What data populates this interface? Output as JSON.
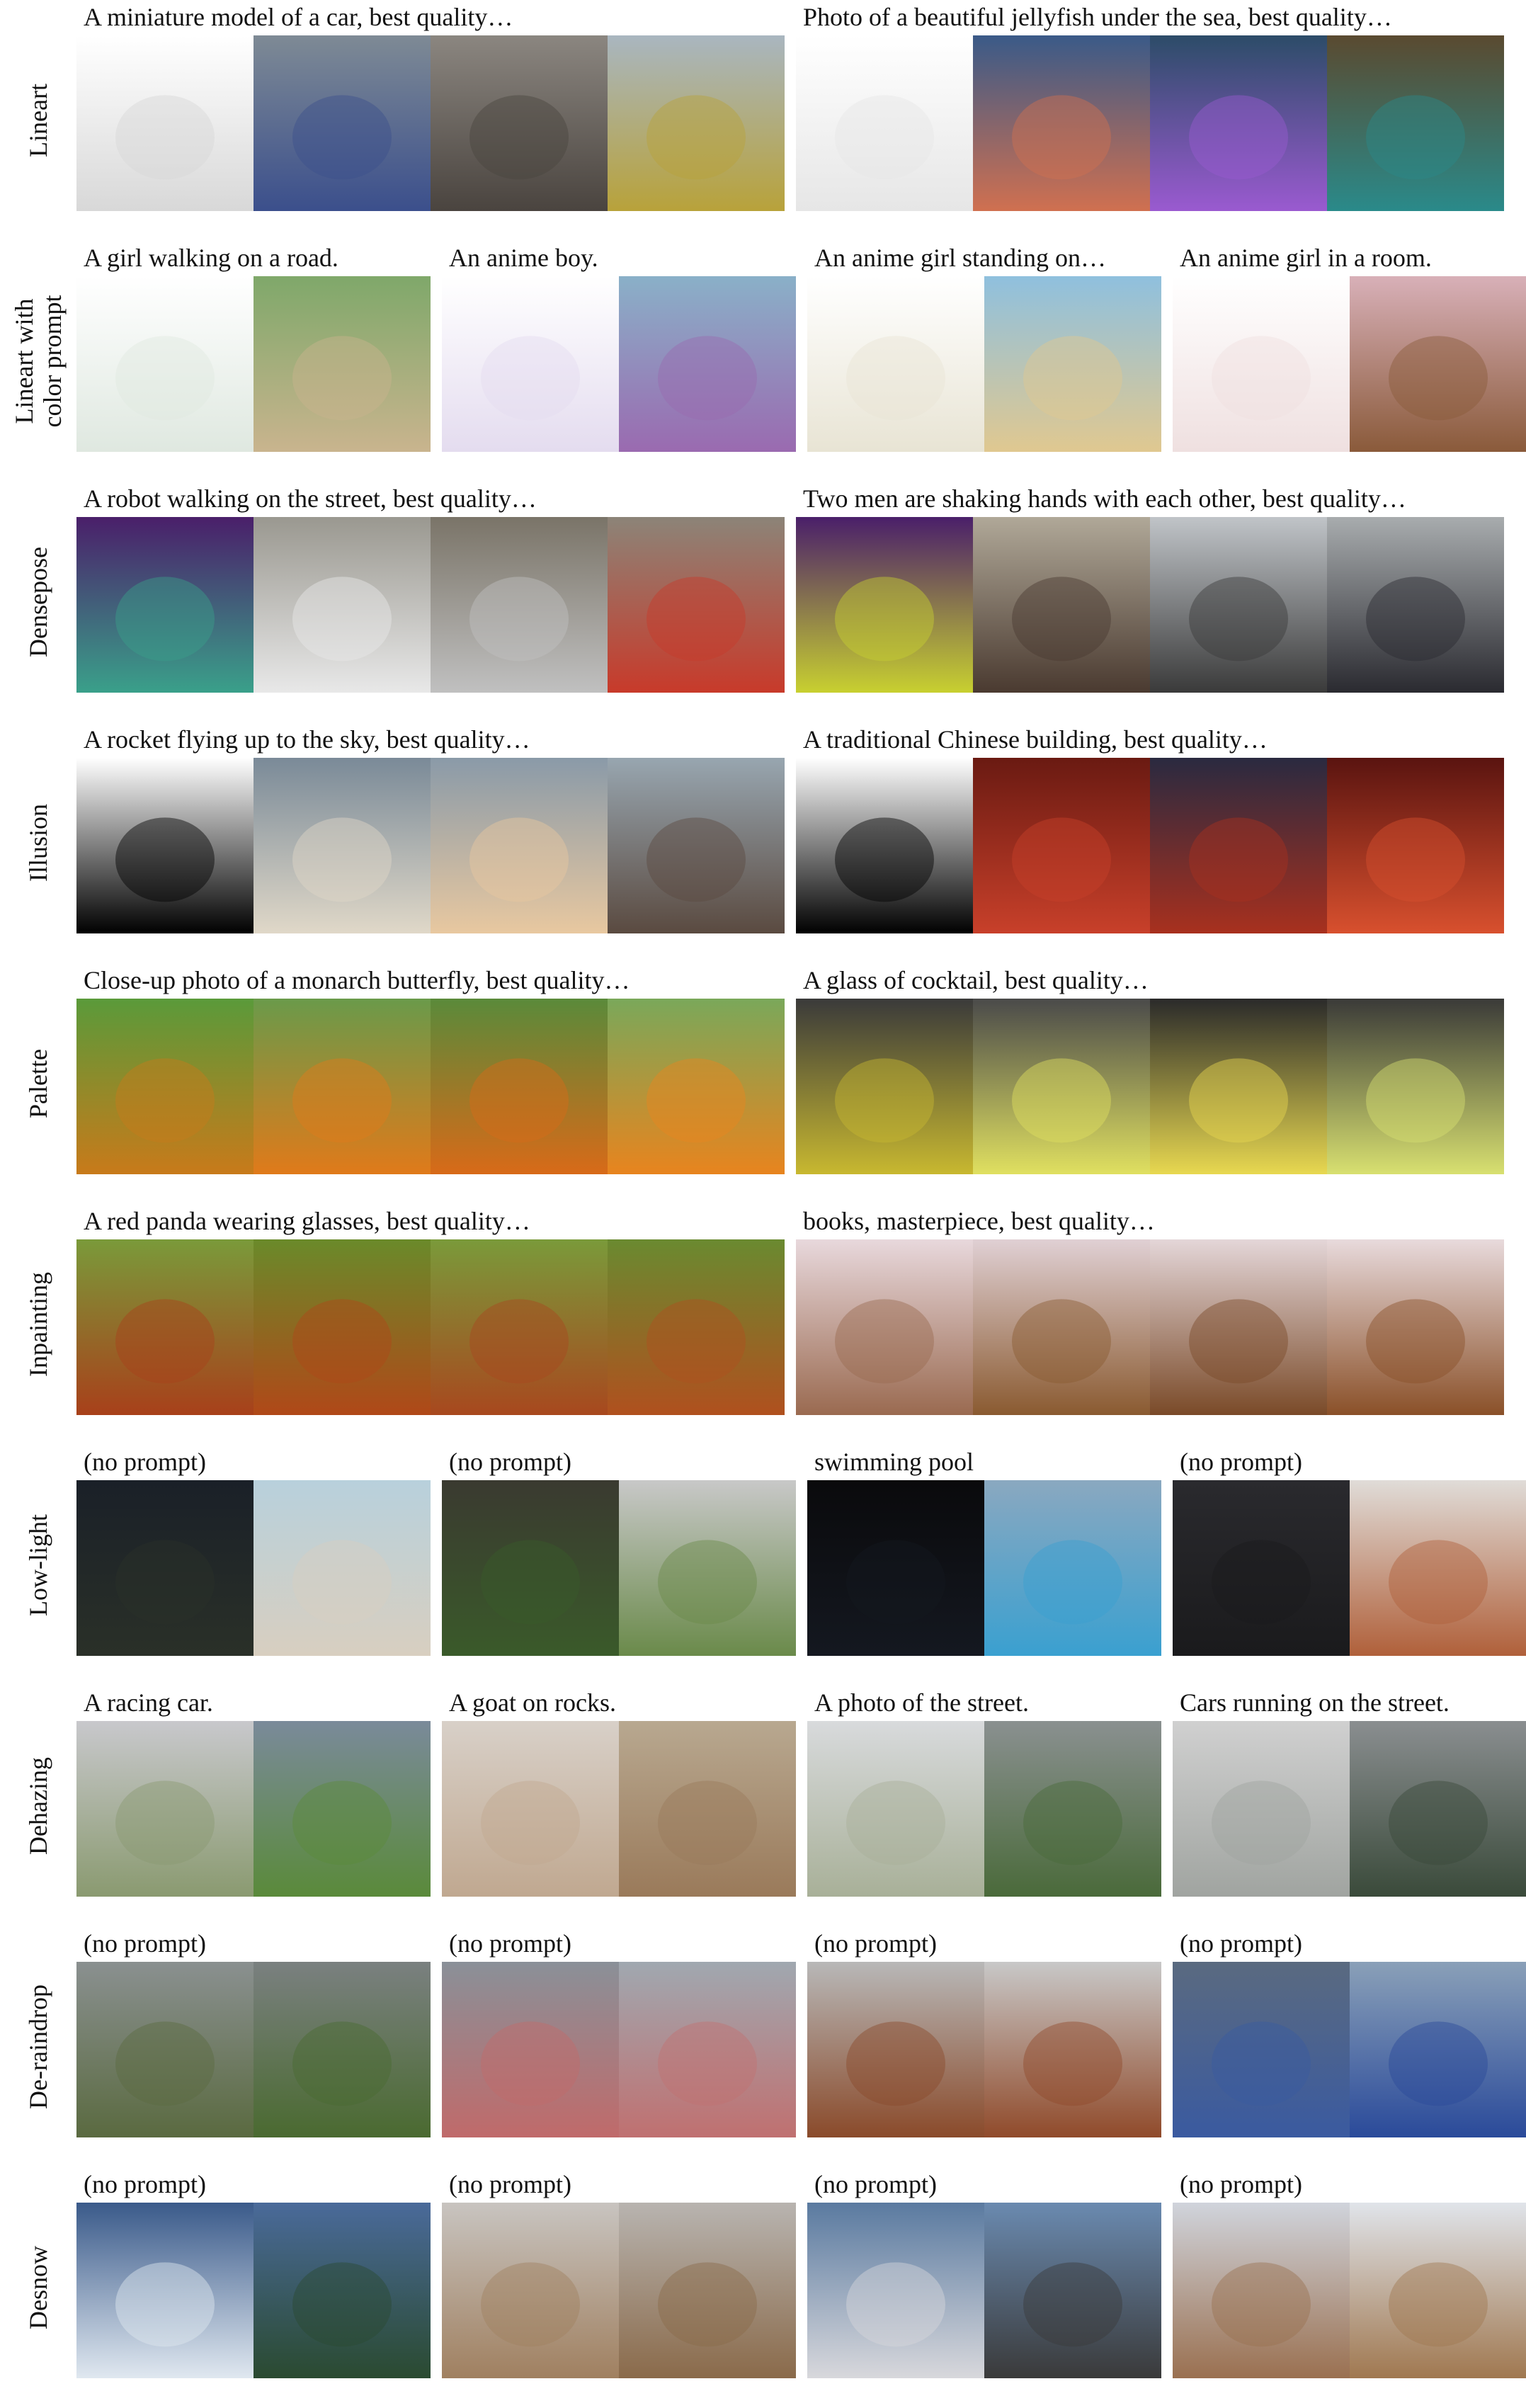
{
  "rows": [
    {
      "label": "Lineart",
      "groups": [
        {
          "caption": "A miniature model of a car, best quality…",
          "panels": [
            {
              "icon": "car-sketch",
              "a": "#ffffff",
              "b": "#d8d8d8"
            },
            {
              "icon": "car-photo-blue",
              "a": "#7e8a95",
              "b": "#3b4f8c"
            },
            {
              "icon": "car-photo-white",
              "a": "#8b8680",
              "b": "#4a443f"
            },
            {
              "icon": "car-photo-yellow",
              "a": "#a9b6c0",
              "b": "#b8a23a"
            }
          ]
        },
        {
          "caption": "Photo of a beautiful jellyfish under the sea, best quality…",
          "panels": [
            {
              "icon": "jellyfish-sketch",
              "a": "#ffffff",
              "b": "#e6e6e6"
            },
            {
              "icon": "jellyfish-red",
              "a": "#3a5a88",
              "b": "#d07050"
            },
            {
              "icon": "jellyfish-purple",
              "a": "#2c4c68",
              "b": "#9a5ad0"
            },
            {
              "icon": "jellyfish-teal",
              "a": "#5a4a30",
              "b": "#2a8a8a"
            }
          ]
        }
      ]
    },
    {
      "label": "Lineart with\ncolor prompt",
      "groups": [
        {
          "caption": "A girl walking on a road.",
          "panels": [
            {
              "icon": "color-dots-sketch",
              "a": "#ffffff",
              "b": "#dfe8e0"
            },
            {
              "icon": "anime-girl-road",
              "a": "#7fa86a",
              "b": "#c9b48e"
            }
          ]
        },
        {
          "caption": "An anime boy.",
          "panels": [
            {
              "icon": "color-dots-sketch",
              "a": "#ffffff",
              "b": "#e4dcef"
            },
            {
              "icon": "anime-boy",
              "a": "#8ab0c8",
              "b": "#9a6ab0"
            }
          ]
        },
        {
          "caption": "An anime girl standing on…",
          "panels": [
            {
              "icon": "color-dots-sketch",
              "a": "#ffffff",
              "b": "#e8e4d4"
            },
            {
              "icon": "anime-girl-beach",
              "a": "#8fc0de",
              "b": "#e0c890"
            }
          ]
        },
        {
          "caption": "An anime girl in a room.",
          "panels": [
            {
              "icon": "color-dots-sketch",
              "a": "#ffffff",
              "b": "#efe0e0"
            },
            {
              "icon": "anime-girl-room",
              "a": "#d8b0b8",
              "b": "#8a5a3a"
            }
          ]
        }
      ]
    },
    {
      "label": "Densepose",
      "groups": [
        {
          "caption": "A robot walking on the street, best quality…",
          "panels": [
            {
              "icon": "densepose-map",
              "a": "#4a1f6a",
              "b": "#3aa08a"
            },
            {
              "icon": "robot-white",
              "a": "#9a9890",
              "b": "#e8e8e8"
            },
            {
              "icon": "robot-silver",
              "a": "#7a7468",
              "b": "#c0c0c0"
            },
            {
              "icon": "robot-red",
              "a": "#8c8478",
              "b": "#c83a2a"
            }
          ]
        },
        {
          "caption": "Two men are shaking hands with each other, best quality…",
          "panels": [
            {
              "icon": "densepose-map",
              "a": "#4a1f6a",
              "b": "#c8d030"
            },
            {
              "icon": "men-handshake",
              "a": "#b0a898",
              "b": "#4a3a30"
            },
            {
              "icon": "men-handshake",
              "a": "#c0c4c8",
              "b": "#3a3a3a"
            },
            {
              "icon": "men-handshake",
              "a": "#a8acae",
              "b": "#2a2a30"
            }
          ]
        }
      ]
    },
    {
      "label": "Illusion",
      "groups": [
        {
          "caption": "A rocket flying up to the sky, best quality…",
          "panels": [
            {
              "icon": "penguin-silhouette",
              "a": "#ffffff",
              "b": "#000000"
            },
            {
              "icon": "rocket-launch",
              "a": "#7a8a98",
              "b": "#e0d8c8"
            },
            {
              "icon": "rocket-launch",
              "a": "#8a9aa8",
              "b": "#e8c8a0"
            },
            {
              "icon": "rocket-launch",
              "a": "#98a6b0",
              "b": "#5a4a40"
            }
          ]
        },
        {
          "caption": "A traditional Chinese building, best quality…",
          "panels": [
            {
              "icon": "peace-symbol",
              "a": "#ffffff",
              "b": "#000000"
            },
            {
              "icon": "chinese-building",
              "a": "#6a1a12",
              "b": "#c8402a"
            },
            {
              "icon": "chinese-building",
              "a": "#2a2a40",
              "b": "#a8301e"
            },
            {
              "icon": "chinese-building",
              "a": "#5a1410",
              "b": "#d8502e"
            }
          ]
        }
      ]
    },
    {
      "label": "Palette",
      "groups": [
        {
          "caption": "Close-up photo of a monarch butterfly, best quality…",
          "panels": [
            {
              "icon": "pixel-palette",
              "a": "#5a9a3a",
              "b": "#c87a1a"
            },
            {
              "icon": "butterfly",
              "a": "#6a9a4a",
              "b": "#e07a1a"
            },
            {
              "icon": "butterfly",
              "a": "#5a8a3a",
              "b": "#d86a18"
            },
            {
              "icon": "butterfly",
              "a": "#7aa85a",
              "b": "#e8841e"
            }
          ]
        },
        {
          "caption": "A glass of cocktail, best quality…",
          "panels": [
            {
              "icon": "pixel-palette",
              "a": "#3a3a3a",
              "b": "#c8b830"
            },
            {
              "icon": "cocktail-glass",
              "a": "#4a4a4a",
              "b": "#e0e060"
            },
            {
              "icon": "cocktail-glass",
              "a": "#2a2a2a",
              "b": "#e8d850"
            },
            {
              "icon": "cocktail-glass",
              "a": "#3a3a38",
              "b": "#d8e070"
            }
          ]
        }
      ]
    },
    {
      "label": "Inpainting",
      "groups": [
        {
          "caption": "A red panda wearing glasses, best quality…",
          "panels": [
            {
              "icon": "red-panda-masked",
              "a": "#7a9a3a",
              "b": "#a8401a"
            },
            {
              "icon": "red-panda-glasses",
              "a": "#6a8a2a",
              "b": "#b04818"
            },
            {
              "icon": "red-panda-glasses",
              "a": "#7a9a3a",
              "b": "#a8481e"
            },
            {
              "icon": "red-panda-glasses",
              "a": "#6a8a30",
              "b": "#b0501e"
            }
          ]
        },
        {
          "caption": "books, masterpiece, best quality…",
          "panels": [
            {
              "icon": "face-masked",
              "a": "#e8d8dc",
              "b": "#9a6a50"
            },
            {
              "icon": "book-stack",
              "a": "#e0d0d4",
              "b": "#8a5a30"
            },
            {
              "icon": "book-stack",
              "a": "#e4d6d8",
              "b": "#7a4a28"
            },
            {
              "icon": "book-stack",
              "a": "#e8dadc",
              "b": "#8a5028"
            }
          ]
        }
      ]
    },
    {
      "label": "Low-light",
      "groups": [
        {
          "caption": "(no prompt)",
          "panels": [
            {
              "icon": "beach-dark",
              "a": "#1a2028",
              "b": "#2a3028"
            },
            {
              "icon": "beach-bright",
              "a": "#b8d0dc",
              "b": "#d8cfc0"
            }
          ]
        },
        {
          "caption": "(no prompt)",
          "panels": [
            {
              "icon": "ruins-dark",
              "a": "#3a3a30",
              "b": "#3a5a2a"
            },
            {
              "icon": "ruins-bright",
              "a": "#c8c8c8",
              "b": "#6a8a4a"
            }
          ]
        },
        {
          "caption": "swimming pool",
          "panels": [
            {
              "icon": "pool-dark",
              "a": "#0a0a0c",
              "b": "#141820"
            },
            {
              "icon": "pool-bright",
              "a": "#8aa8c0",
              "b": "#3aa0d0"
            }
          ]
        },
        {
          "caption": "(no prompt)",
          "panels": [
            {
              "icon": "room-dark",
              "a": "#2a2a2e",
              "b": "#1a1a1c"
            },
            {
              "icon": "room-bright",
              "a": "#e0dcd8",
              "b": "#b0603a"
            }
          ]
        }
      ]
    },
    {
      "label": "Dehazing",
      "groups": [
        {
          "caption": "A racing car.",
          "panels": [
            {
              "icon": "race-car-hazy",
              "a": "#c8c8cc",
              "b": "#8a9a70"
            },
            {
              "icon": "race-car-clear",
              "a": "#7a8a9a",
              "b": "#5a8a3a"
            }
          ]
        },
        {
          "caption": "A goat on rocks.",
          "panels": [
            {
              "icon": "goat-hazy",
              "a": "#d8d0c8",
              "b": "#c0a890"
            },
            {
              "icon": "goat-clear",
              "a": "#b8a890",
              "b": "#9a7a5a"
            }
          ]
        },
        {
          "caption": "A photo of the street.",
          "panels": [
            {
              "icon": "street-hazy",
              "a": "#d8dadc",
              "b": "#a8b098"
            },
            {
              "icon": "street-clear",
              "a": "#8a9090",
              "b": "#4a6a3a"
            }
          ]
        },
        {
          "caption": "Cars running on the street.",
          "panels": [
            {
              "icon": "road-hazy",
              "a": "#d0d0d0",
              "b": "#a0a4a0"
            },
            {
              "icon": "road-clear",
              "a": "#8a8e90",
              "b": "#3a4a3a"
            }
          ]
        }
      ]
    },
    {
      "label": "De-raindrop",
      "groups": [
        {
          "caption": "(no prompt)",
          "panels": [
            {
              "icon": "path-raindrops",
              "a": "#8a9090",
              "b": "#5a6a40"
            },
            {
              "icon": "path-clear",
              "a": "#7a8080",
              "b": "#4a6a30"
            }
          ]
        },
        {
          "caption": "(no prompt)",
          "panels": [
            {
              "icon": "building-raindrops",
              "a": "#8a9098",
              "b": "#c06a6a"
            },
            {
              "icon": "building-clear",
              "a": "#a0a8b0",
              "b": "#c07070"
            }
          ]
        },
        {
          "caption": "(no prompt)",
          "panels": [
            {
              "icon": "tower-raindrops",
              "a": "#b8b8b8",
              "b": "#8a4a2a"
            },
            {
              "icon": "tower-clear",
              "a": "#c8c8c8",
              "b": "#904a2a"
            }
          ]
        },
        {
          "caption": "(no prompt)",
          "panels": [
            {
              "icon": "benches-raindrops",
              "a": "#5a6a80",
              "b": "#3a5aa0"
            },
            {
              "icon": "benches-clear",
              "a": "#8aa0b8",
              "b": "#2a4a9a"
            }
          ]
        }
      ]
    },
    {
      "label": "Desnow",
      "groups": [
        {
          "caption": "(no prompt)",
          "panels": [
            {
              "icon": "forest-snowfall",
              "a": "#3a5a8a",
              "b": "#e0e8f0"
            },
            {
              "icon": "forest-clear",
              "a": "#4a6a9a",
              "b": "#2a4a30"
            }
          ]
        },
        {
          "caption": "(no prompt)",
          "panels": [
            {
              "icon": "wolf-snowfall",
              "a": "#c8c4c0",
              "b": "#a08060"
            },
            {
              "icon": "wolf-clear",
              "a": "#b8b4b0",
              "b": "#8a6a4a"
            }
          ]
        },
        {
          "caption": "(no prompt)",
          "panels": [
            {
              "icon": "house-snowfall",
              "a": "#5a7aa0",
              "b": "#d8d8dc"
            },
            {
              "icon": "house-clear",
              "a": "#6a8ab0",
              "b": "#3a3a3a"
            }
          ]
        },
        {
          "caption": "(no prompt)",
          "panels": [
            {
              "icon": "deer-snowfall",
              "a": "#d0d4dc",
              "b": "#9a7050"
            },
            {
              "icon": "deer-clear",
              "a": "#e0e4ea",
              "b": "#a07850"
            }
          ]
        }
      ]
    }
  ]
}
